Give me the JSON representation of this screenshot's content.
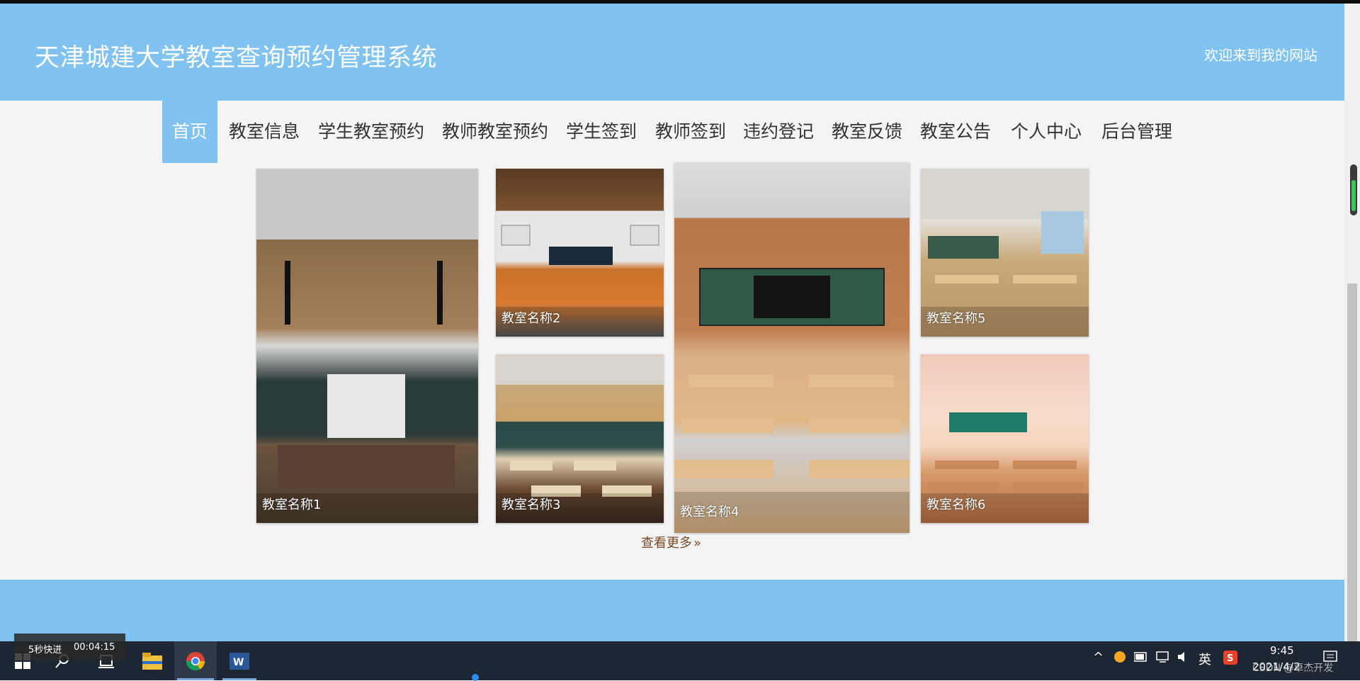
{
  "header": {
    "title": "天津城建大学教室查询预约管理系统",
    "welcome": "欢迎来到我的网站",
    "bg_color": "#80c3f1"
  },
  "nav": {
    "items": [
      {
        "label": "首页",
        "active": true
      },
      {
        "label": "教室信息"
      },
      {
        "label": "学生教室预约"
      },
      {
        "label": "教师教室预约"
      },
      {
        "label": "学生签到"
      },
      {
        "label": "教师签到"
      },
      {
        "label": "违约登记"
      },
      {
        "label": "教室反馈"
      },
      {
        "label": "教室公告"
      },
      {
        "label": "个人中心"
      },
      {
        "label": "后台管理"
      }
    ]
  },
  "gallery": {
    "tiles": [
      {
        "caption": "教室名称1"
      },
      {
        "caption": "教室名称2"
      },
      {
        "caption": "教室名称3"
      },
      {
        "caption": "教室名称4"
      },
      {
        "caption": "教室名称5"
      },
      {
        "caption": "教室名称6"
      }
    ],
    "more_label": "查看更多",
    "more_icon": "double-chevron-right-icon"
  },
  "overlay": {
    "speed_label": "5秒快进",
    "time": "00:04:15"
  },
  "taskbar": {
    "icons": [
      "windows-start-icon",
      "search-icon",
      "task-view-icon",
      "file-explorer-icon",
      "chrome-icon",
      "word-icon"
    ],
    "tray": {
      "ime": "英",
      "time": "9:45",
      "date": "2021/4/2",
      "watermark": "CSDN @卓杰开发"
    }
  }
}
